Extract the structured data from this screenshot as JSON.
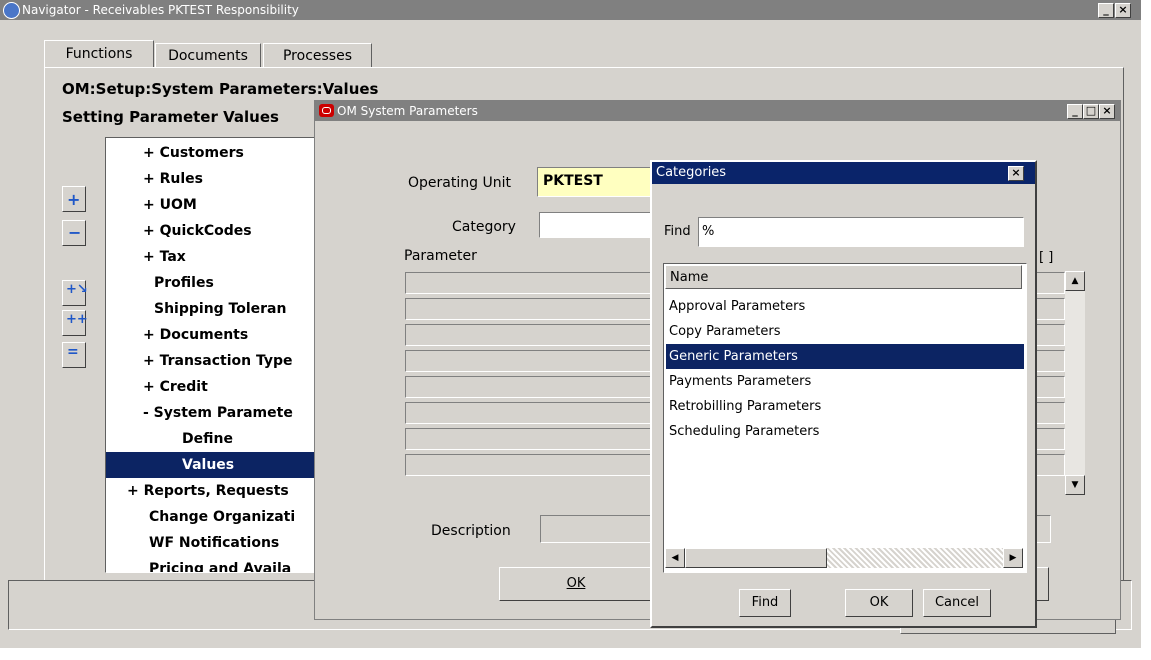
{
  "navigator": {
    "title": "Navigator - Receivables PKTEST Responsibility",
    "tabs": [
      "Functions",
      "Documents",
      "Processes"
    ],
    "path": "OM:Setup:System Parameters:Values",
    "subtitle": "Setting Parameter Values",
    "tree": [
      "+ Customers",
      "+ Rules",
      "+ UOM",
      "+ QuickCodes",
      "+ Tax",
      "Profiles",
      "Shipping Toleran",
      "+ Documents",
      "+ Transaction Type",
      "+ Credit",
      "- System Paramete",
      "Define",
      "Values",
      "+ Reports, Requests",
      "Change Organizati",
      "WF Notifications",
      "Pricing and Availa"
    ],
    "selected_tree_item": "Values"
  },
  "om_params": {
    "title": "OM System Parameters",
    "operating_unit_label": "Operating Unit",
    "operating_unit_value": "PKTEST",
    "category_label": "Category",
    "category_value": "",
    "parameter_label": "Parameter",
    "description_label": "Description",
    "ok_label": "OK",
    "bracket_label": "[ ]"
  },
  "categories": {
    "title": "Categories",
    "find_label": "Find",
    "find_value": "%",
    "column_name": "Name",
    "items": [
      "Approval Parameters",
      "Copy Parameters",
      "Generic Parameters",
      "Payments Parameters",
      "Retrobilling Parameters",
      "Scheduling Parameters"
    ],
    "selected_item": "Generic Parameters",
    "find_button": "Find",
    "ok_button": "OK",
    "cancel_button": "Cancel"
  },
  "colors": {
    "selection": "#0c2463",
    "required_field": "#ffffc0",
    "window_bg": "#d6d3ce",
    "inactive_title": "#808080",
    "active_title": "#0a246a",
    "oracle_red": "#cc0000"
  }
}
